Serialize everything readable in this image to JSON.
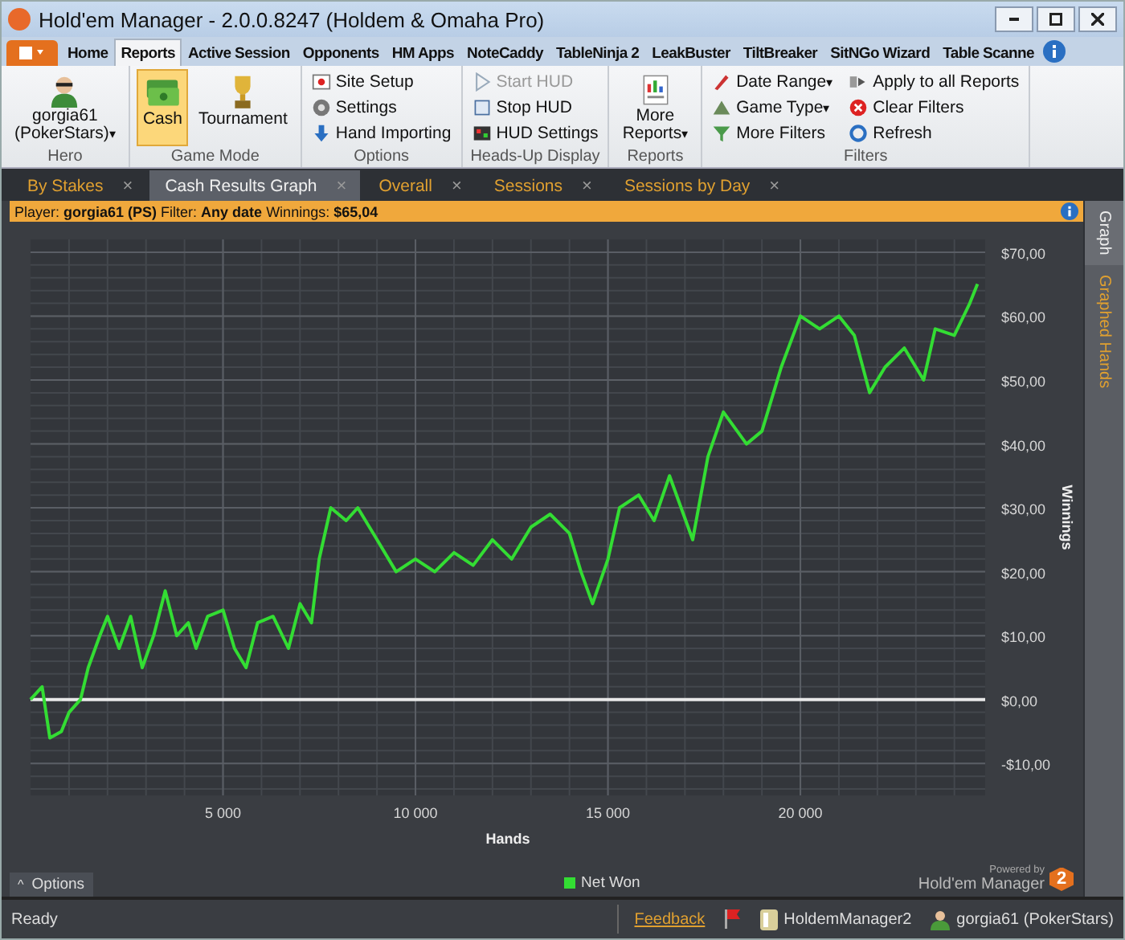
{
  "window": {
    "title": "Hold'em Manager - 2.0.0.8247 (Holdem & Omaha Pro)"
  },
  "ribbon_tabs": [
    {
      "label": "Home",
      "selected": false
    },
    {
      "label": "Reports",
      "selected": true
    },
    {
      "label": "Active Session",
      "selected": false
    },
    {
      "label": "Opponents",
      "selected": false
    },
    {
      "label": "HM Apps",
      "selected": false
    },
    {
      "label": "NoteCaddy",
      "selected": false
    },
    {
      "label": "TableNinja 2",
      "selected": false
    },
    {
      "label": "LeakBuster",
      "selected": false
    },
    {
      "label": "TiltBreaker",
      "selected": false
    },
    {
      "label": "SitNGo Wizard",
      "selected": false
    },
    {
      "label": "Table Scanne",
      "selected": false
    }
  ],
  "dropdown_glyph": "▾",
  "ribbon_groups": [
    {
      "label": "Hero",
      "buttons": [
        {
          "kind": "large",
          "label": "gorgia61\n(PokerStars)",
          "dropdown": true,
          "selected": false,
          "disabled": false
        }
      ]
    },
    {
      "label": "Game Mode",
      "buttons": [
        {
          "kind": "large",
          "label": "Cash",
          "dropdown": false,
          "selected": true,
          "disabled": false
        },
        {
          "kind": "large",
          "label": "Tournament",
          "dropdown": false,
          "selected": false,
          "disabled": false
        }
      ]
    },
    {
      "label": "Options",
      "buttons": [
        {
          "kind": "small",
          "label": "Site Setup",
          "dropdown": false,
          "selected": false,
          "disabled": false
        },
        {
          "kind": "small",
          "label": "Settings",
          "dropdown": false,
          "selected": false,
          "disabled": false
        },
        {
          "kind": "small",
          "label": "Hand Importing",
          "dropdown": false,
          "selected": false,
          "disabled": false
        }
      ]
    },
    {
      "label": "Heads-Up Display",
      "buttons": [
        {
          "kind": "small",
          "label": "Start HUD",
          "dropdown": false,
          "selected": false,
          "disabled": true
        },
        {
          "kind": "small",
          "label": "Stop HUD",
          "dropdown": false,
          "selected": false,
          "disabled": false
        },
        {
          "kind": "small",
          "label": "HUD Settings",
          "dropdown": false,
          "selected": false,
          "disabled": false
        }
      ]
    },
    {
      "label": "Reports",
      "buttons": [
        {
          "kind": "large",
          "label": "More\nReports",
          "dropdown": true,
          "selected": false,
          "disabled": false
        }
      ]
    },
    {
      "label": "Filters",
      "buttons": [
        {
          "kind": "small",
          "label": "Date Range",
          "dropdown": true,
          "selected": false,
          "disabled": false
        },
        {
          "kind": "small",
          "label": "Game Type",
          "dropdown": true,
          "selected": false,
          "disabled": false
        },
        {
          "kind": "small",
          "label": "More Filters",
          "dropdown": false,
          "selected": false,
          "disabled": false
        },
        {
          "kind": "small",
          "label": "Apply to all Reports",
          "dropdown": false,
          "selected": false,
          "disabled": false
        },
        {
          "kind": "small",
          "label": "Clear Filters",
          "dropdown": false,
          "selected": false,
          "disabled": false
        },
        {
          "kind": "small",
          "label": "Refresh",
          "dropdown": false,
          "selected": false,
          "disabled": false
        }
      ]
    }
  ],
  "doc_tabs": [
    {
      "label": "By Stakes",
      "selected": false
    },
    {
      "label": "Cash Results Graph",
      "selected": true
    },
    {
      "label": "Overall",
      "selected": false
    },
    {
      "label": "Sessions",
      "selected": false
    },
    {
      "label": "Sessions by Day",
      "selected": false
    }
  ],
  "close_glyph": "×",
  "info_bar": "Player: **gorgia61 (PS)** Filter: **Any date** Winnings: **$65,04**",
  "side_tabs": [
    {
      "label": "Graph",
      "selected": true
    },
    {
      "label": "Graphed Hands",
      "selected": false
    }
  ],
  "chart": {
    "chart_data": {
      "type": "line",
      "xlabel": "Hands",
      "ylabel": "Winnings",
      "grid": true,
      "x": [
        0,
        300,
        500,
        800,
        1000,
        1300,
        1500,
        1800,
        2000,
        2300,
        2600,
        2900,
        3200,
        3500,
        3800,
        4100,
        4300,
        4600,
        5000,
        5300,
        5600,
        5900,
        6300,
        6700,
        7000,
        7300,
        7500,
        7800,
        8200,
        8500,
        9000,
        9500,
        10000,
        10500,
        11000,
        11500,
        12000,
        12500,
        13000,
        13500,
        14000,
        14300,
        14600,
        15000,
        15300,
        15800,
        16200,
        16600,
        17200,
        17600,
        18000,
        18600,
        19000,
        19500,
        20000,
        20500,
        21000,
        21400,
        21800,
        22200,
        22700,
        23200,
        23500,
        24000,
        24400,
        24600
      ],
      "series": [
        {
          "name": "Net Won",
          "color": "#33dd33",
          "values": [
            0,
            2,
            -6,
            -5,
            -2,
            0,
            5,
            10,
            13,
            8,
            13,
            5,
            10,
            17,
            10,
            12,
            8,
            13,
            14,
            8,
            5,
            12,
            13,
            8,
            15,
            12,
            22,
            30,
            28,
            30,
            25,
            20,
            22,
            20,
            23,
            21,
            25,
            22,
            27,
            29,
            26,
            20,
            15,
            22,
            30,
            32,
            28,
            35,
            25,
            38,
            45,
            40,
            42,
            52,
            60,
            58,
            60,
            57,
            48,
            52,
            55,
            50,
            58,
            57,
            62,
            65
          ]
        }
      ],
      "xlim": [
        0,
        24800
      ],
      "ylim": [
        -15,
        72
      ],
      "xticks": [
        {
          "value": 5000,
          "label": "5 000"
        },
        {
          "value": 10000,
          "label": "10 000"
        },
        {
          "value": 15000,
          "label": "15 000"
        },
        {
          "value": 20000,
          "label": "20 000"
        }
      ],
      "yticks": [
        {
          "value": -10,
          "label": "-$10,00"
        },
        {
          "value": 0,
          "label": "$0,00"
        },
        {
          "value": 10,
          "label": "$10,00"
        },
        {
          "value": 20,
          "label": "$20,00"
        },
        {
          "value": 30,
          "label": "$30,00"
        },
        {
          "value": 40,
          "label": "$40,00"
        },
        {
          "value": 50,
          "label": "$50,00"
        },
        {
          "value": 60,
          "label": "$60,00"
        },
        {
          "value": 70,
          "label": "$70,00"
        }
      ]
    }
  },
  "options_button": {
    "glyph": "^",
    "label": "Options"
  },
  "branding": {
    "tagline": "Powered by",
    "name": "Hold'em Manager",
    "badge": "2"
  },
  "status_bar": {
    "status": "Ready",
    "feedback": "Feedback",
    "items": [
      "HoldemManager2",
      "gorgia61 (PokerStars)"
    ]
  }
}
